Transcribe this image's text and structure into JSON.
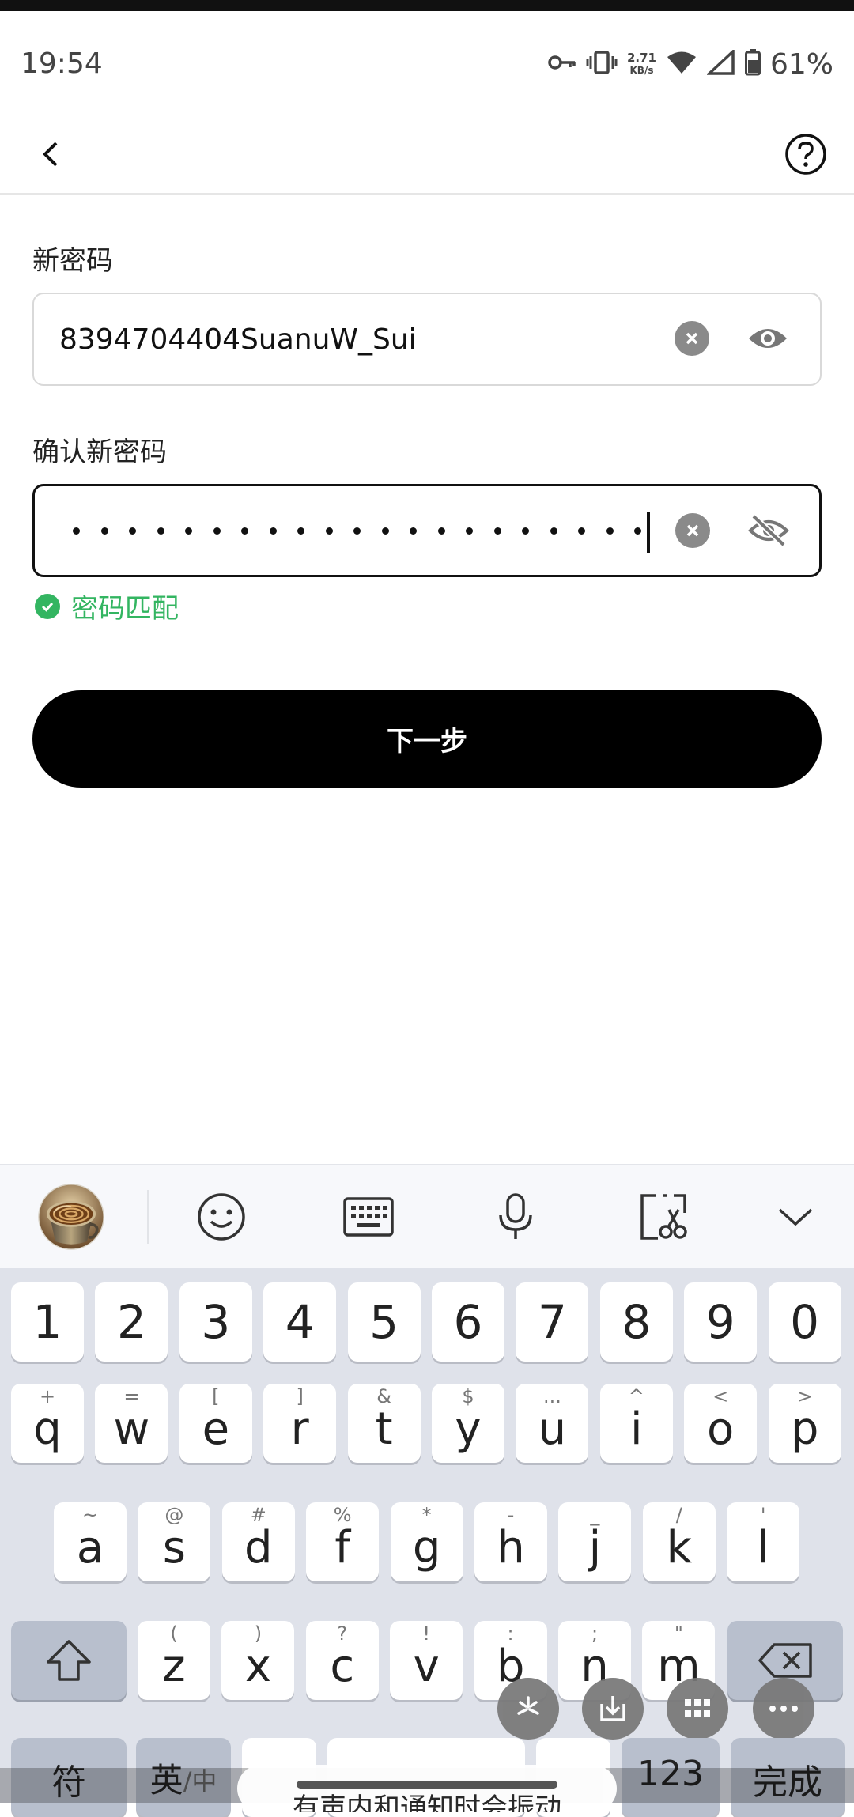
{
  "status_bar": {
    "time": "19:54",
    "net_speed_value": "2.71",
    "net_speed_unit": "KB/s",
    "battery": "61%"
  },
  "header": {
    "back_icon": "chevron-left-icon",
    "help_icon": "question-circle-icon"
  },
  "form": {
    "new_password_label": "新密码",
    "new_password_value": "8394704404SuanuW_Sui",
    "confirm_password_label": "确认新密码",
    "confirm_password_masked_count": 21,
    "match_text": "密码匹配",
    "match_color": "#33b561"
  },
  "next_button": {
    "label": "下一步"
  },
  "keyboard": {
    "toolbar": [
      "avatar",
      "emoji-icon",
      "keyboard-icon",
      "microphone-icon",
      "clipboard-scissors-icon",
      "collapse-chevron-icon"
    ],
    "number_row": [
      "1",
      "2",
      "3",
      "4",
      "5",
      "6",
      "7",
      "8",
      "9",
      "0"
    ],
    "row1": [
      {
        "key": "q",
        "hint": "+"
      },
      {
        "key": "w",
        "hint": "="
      },
      {
        "key": "e",
        "hint": "["
      },
      {
        "key": "r",
        "hint": "]"
      },
      {
        "key": "t",
        "hint": "&"
      },
      {
        "key": "y",
        "hint": "$"
      },
      {
        "key": "u",
        "hint": "..."
      },
      {
        "key": "i",
        "hint": "^"
      },
      {
        "key": "o",
        "hint": "<"
      },
      {
        "key": "p",
        "hint": ">"
      }
    ],
    "row2": [
      {
        "key": "a",
        "hint": "~"
      },
      {
        "key": "s",
        "hint": "@"
      },
      {
        "key": "d",
        "hint": "#"
      },
      {
        "key": "f",
        "hint": "%"
      },
      {
        "key": "g",
        "hint": "*"
      },
      {
        "key": "h",
        "hint": "-"
      },
      {
        "key": "j",
        "hint": "_"
      },
      {
        "key": "k",
        "hint": "/"
      },
      {
        "key": "l",
        "hint": "'"
      }
    ],
    "row3": [
      {
        "key": "z",
        "hint": "("
      },
      {
        "key": "x",
        "hint": ")"
      },
      {
        "key": "c",
        "hint": "?"
      },
      {
        "key": "v",
        "hint": "!"
      },
      {
        "key": "b",
        "hint": ":"
      },
      {
        "key": "n",
        "hint": ";"
      },
      {
        "key": "m",
        "hint": "\""
      }
    ],
    "bottom": {
      "symbols": "符",
      "lang_en": "英",
      "lang_zh": "/中",
      "numbers": "123",
      "done": "完成"
    },
    "toast_text": "有声内和通知时会振动"
  }
}
